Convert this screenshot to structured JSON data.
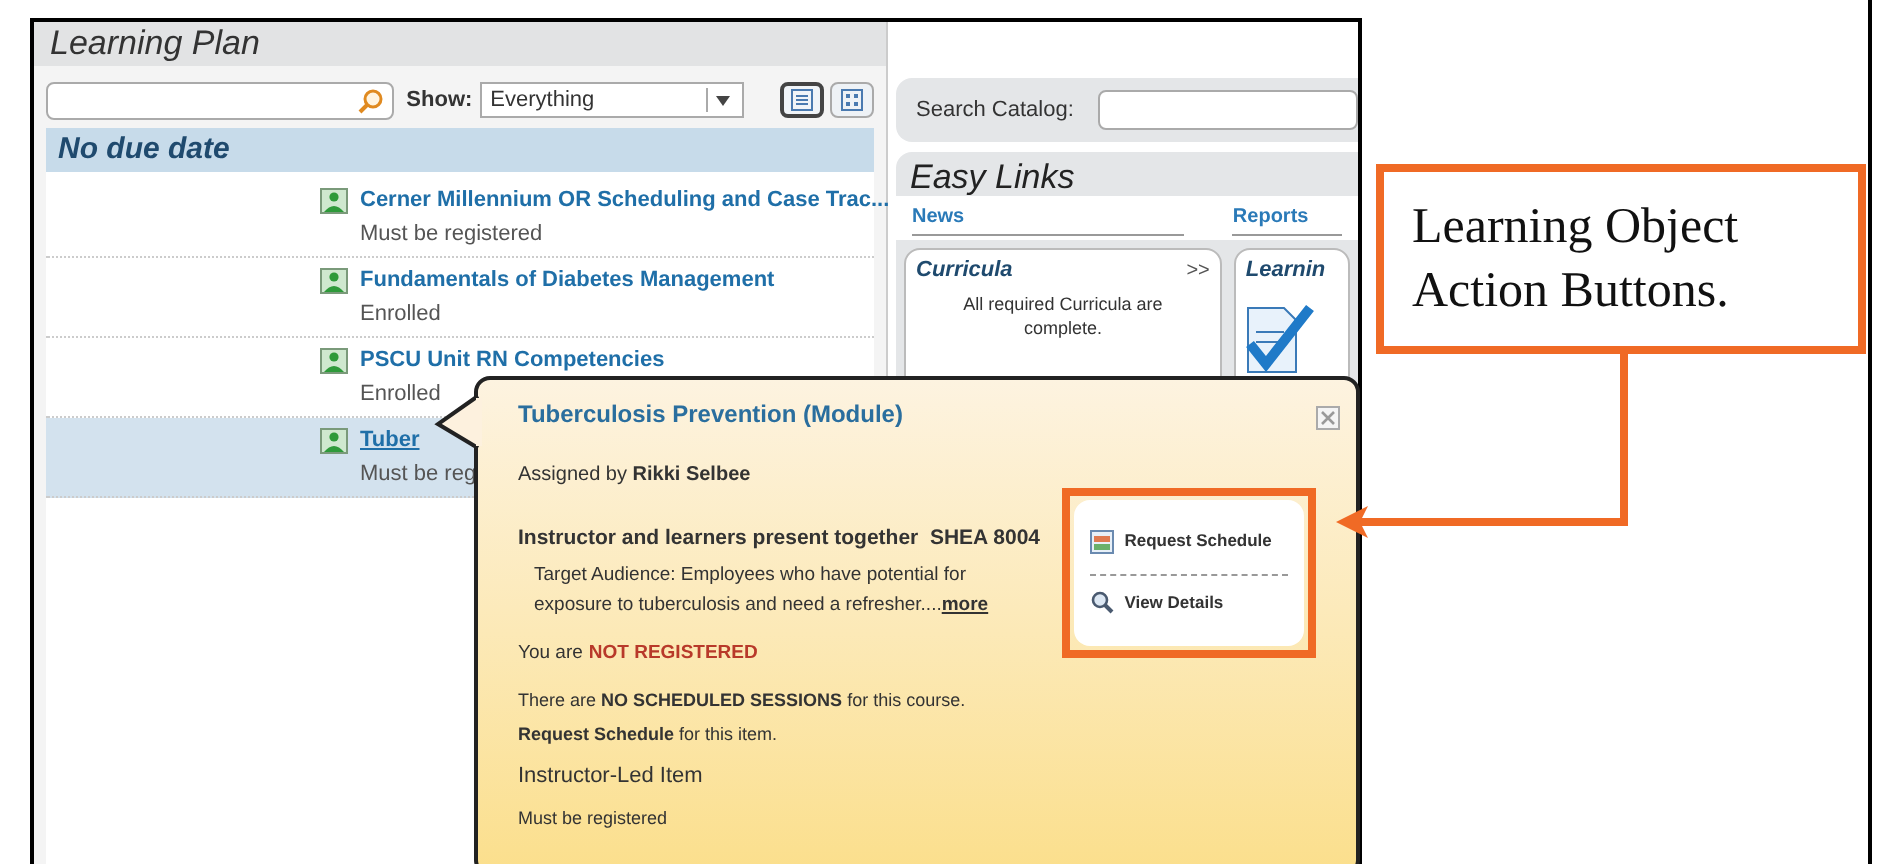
{
  "learning_plan": {
    "title": "Learning Plan",
    "show_label": "Show:",
    "show_value": "Everything",
    "views": [
      {
        "kind": "list",
        "selected": true
      },
      {
        "kind": "grid",
        "selected": false
      }
    ],
    "group": "No due date",
    "items": [
      {
        "title": "Cerner Millennium OR Scheduling and Case Trac...",
        "status": "Must be registered",
        "selected": false
      },
      {
        "title": "Fundamentals of Diabetes Management",
        "status": "Enrolled",
        "selected": false
      },
      {
        "title": "PSCU Unit RN Competencies",
        "status": "Enrolled",
        "selected": false
      },
      {
        "title": "Tuber",
        "status": "Must be reg",
        "selected": true
      }
    ]
  },
  "catalog": {
    "label": "Search Catalog:"
  },
  "easy_links": {
    "title": "Easy Links",
    "tabs": [
      "News",
      "Reports"
    ],
    "cards": [
      {
        "kind": "text",
        "title": "Curricula",
        "more": ">>",
        "text": "All required Curricula are complete."
      },
      {
        "kind": "icon",
        "title": "Learnin"
      }
    ]
  },
  "popup": {
    "title": "Tuberculosis Prevention (Module)",
    "assigned": "Assigned by **Rikki Selbee**",
    "type_line": "Instructor and learners present together  SHEA 8004",
    "audience": "Target Audience: Employees who have potential for exposure to tuberculosis and need a refresher....",
    "more": "more",
    "status_prefix": "You are",
    "status_value": "NOT REGISTERED",
    "sessions": "There are **NO SCHEDULED SESSIONS** for this course.",
    "request": "**Request Schedule** for this item.",
    "item_type": "Instructor-Led Item",
    "item_status": "Must be registered",
    "actions": [
      {
        "kind": "calendar",
        "label": "Request Schedule"
      },
      {
        "kind": "search",
        "label": "View Details"
      }
    ]
  },
  "callout": {
    "text": "Learning Object Action Buttons."
  }
}
